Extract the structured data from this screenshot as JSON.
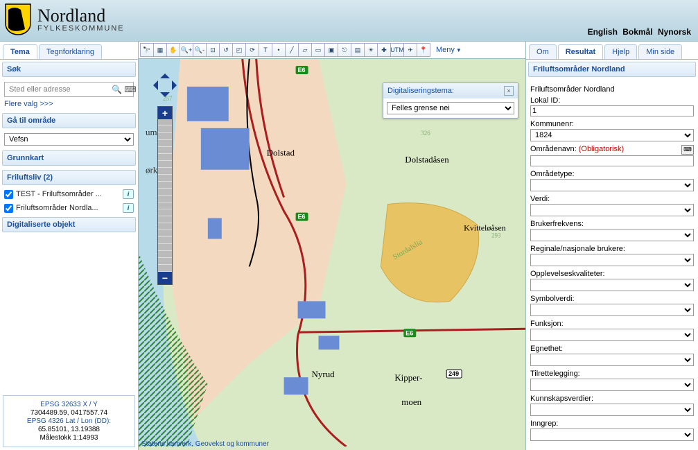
{
  "header": {
    "org_name": "Nordland",
    "org_sub": "FYLKESKOMMUNE",
    "lang_en": "English",
    "lang_bm": "Bokmål",
    "lang_nn": "Nynorsk"
  },
  "left_tabs": {
    "tema": "Tema",
    "tegn": "Tegnforklaring"
  },
  "search": {
    "hdr": "Søk",
    "placeholder": "Sted eller adresse",
    "more": "Flere valg >>>"
  },
  "goto": {
    "hdr": "Gå til område",
    "value": "Vefsn"
  },
  "basemap": {
    "hdr": "Grunnkart"
  },
  "frilufts": {
    "hdr": "Friluftsliv (2)",
    "items": [
      {
        "label": "TEST - Friluftsområder ...",
        "checked": true
      },
      {
        "label": "Friluftsområder Nordla...",
        "checked": true
      }
    ]
  },
  "digi": {
    "hdr": "Digitaliserte objekt"
  },
  "coords": {
    "epsg1": "EPSG 32633 X / Y",
    "xy": "7304489.59, 0417557.74",
    "epsg2": "EPSG 4326 Lat / Lon (DD):",
    "ll": "65.85101, 13.19388",
    "scale": "Målestokk 1:14993"
  },
  "toolbar": {
    "icons": [
      "binoculars-icon",
      "layers-icon",
      "pan-icon",
      "zoom-in-icon",
      "zoom-out-icon",
      "zoom-extent-icon",
      "zoom-prev-icon",
      "zoom-box-icon",
      "refresh-icon",
      "text-icon",
      "draw-point-icon",
      "draw-line-icon",
      "draw-poly-icon",
      "draw-rect-icon",
      "select-icon",
      "split-icon",
      "hatch-icon",
      "sun-icon",
      "plus-red-icon",
      "utm-icon",
      "goto-icon",
      "marker-icon"
    ],
    "glyphs": [
      "🔭",
      "▦",
      "✋",
      "🔍+",
      "🔍-",
      "⊡",
      "↺",
      "◰",
      "⟳",
      "T",
      "•",
      "╱",
      "▱",
      "▭",
      "▣",
      "⎋",
      "▤",
      "☀",
      "✚",
      "UTM",
      "✈",
      "📍"
    ],
    "menu": "Meny"
  },
  "floatbox": {
    "title": "Digitaliseringstema:",
    "value": "Felles grense nei"
  },
  "map": {
    "labels": [
      "umsørket",
      "Dolstad",
      "Dolstadåsen",
      "Kvitteløåsen",
      "Stordalslia",
      "Nyrud",
      "Kipper-",
      "moen"
    ],
    "roads": [
      "E6",
      "E6",
      "249"
    ],
    "spot_heights": [
      "257",
      "326",
      "293"
    ],
    "attribution_pre": "Statens kartverk, Geo",
    "attribution_mid": "vekst",
    "attribution_post": " og kommuner"
  },
  "right_tabs": {
    "om": "Om",
    "res": "Resultat",
    "hjelp": "Hjelp",
    "min": "Min side"
  },
  "result": {
    "hdr": "Friluftsområder Nordland",
    "title": "Friluftsområder Nordland",
    "lokal_id_lbl": "Lokal ID:",
    "lokal_id": "1",
    "komm_lbl": "Kommunenr:",
    "komm": "1824",
    "omraadenavn_lbl": "Områdenavn:",
    "oblig": "(Obligatorisk)",
    "omraadetype_lbl": "Områdetype:",
    "verdi_lbl": "Verdi:",
    "bruker_lbl": "Brukerfrekvens:",
    "reginale_lbl": "Reginale/nasjonale brukere:",
    "oppl_lbl": "Opplevelseskvaliteter:",
    "symbol_lbl": "Symbolverdi:",
    "funksjon_lbl": "Funksjon:",
    "egnethet_lbl": "Egnethet:",
    "tilrette_lbl": "Tilrettelegging:",
    "kunnskap_lbl": "Kunnskapsverdier:",
    "inngrep_lbl": "Inngrep:"
  }
}
